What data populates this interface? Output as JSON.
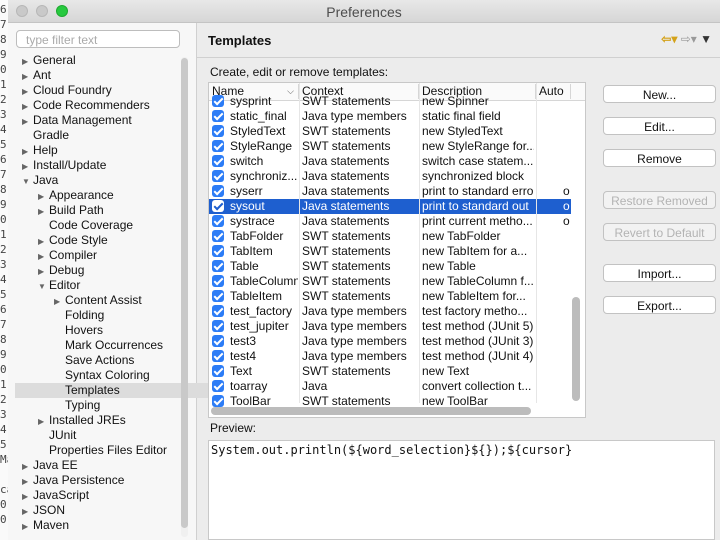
{
  "window": {
    "title": "Preferences"
  },
  "gutter": [
    "6",
    "7",
    "8",
    "9",
    "0",
    "1",
    "2",
    "3",
    "4",
    "5",
    "6",
    "7",
    "8",
    "9",
    "0",
    "1",
    "2",
    "3",
    "4",
    "5",
    "6",
    "7",
    "8",
    "9",
    "0",
    "1",
    "2",
    "3",
    "4",
    "5",
    "Ma",
    "",
    "ca",
    "0",
    "0"
  ],
  "filter": {
    "placeholder": "type filter text"
  },
  "tree": [
    {
      "label": "General",
      "depth": 0,
      "twisty": "right"
    },
    {
      "label": "Ant",
      "depth": 0,
      "twisty": "right"
    },
    {
      "label": "Cloud Foundry",
      "depth": 0,
      "twisty": "right"
    },
    {
      "label": "Code Recommenders",
      "depth": 0,
      "twisty": "right"
    },
    {
      "label": "Data Management",
      "depth": 0,
      "twisty": "right"
    },
    {
      "label": "Gradle",
      "depth": 0,
      "twisty": "none"
    },
    {
      "label": "Help",
      "depth": 0,
      "twisty": "right"
    },
    {
      "label": "Install/Update",
      "depth": 0,
      "twisty": "right"
    },
    {
      "label": "Java",
      "depth": 0,
      "twisty": "down"
    },
    {
      "label": "Appearance",
      "depth": 1,
      "twisty": "right"
    },
    {
      "label": "Build Path",
      "depth": 1,
      "twisty": "right"
    },
    {
      "label": "Code Coverage",
      "depth": 1,
      "twisty": "none"
    },
    {
      "label": "Code Style",
      "depth": 1,
      "twisty": "right"
    },
    {
      "label": "Compiler",
      "depth": 1,
      "twisty": "right"
    },
    {
      "label": "Debug",
      "depth": 1,
      "twisty": "right"
    },
    {
      "label": "Editor",
      "depth": 1,
      "twisty": "down"
    },
    {
      "label": "Content Assist",
      "depth": 2,
      "twisty": "right"
    },
    {
      "label": "Folding",
      "depth": 2,
      "twisty": "none"
    },
    {
      "label": "Hovers",
      "depth": 2,
      "twisty": "none"
    },
    {
      "label": "Mark Occurrences",
      "depth": 2,
      "twisty": "none"
    },
    {
      "label": "Save Actions",
      "depth": 2,
      "twisty": "none"
    },
    {
      "label": "Syntax Coloring",
      "depth": 2,
      "twisty": "none"
    },
    {
      "label": "Templates",
      "depth": 2,
      "twisty": "none",
      "selected": true
    },
    {
      "label": "Typing",
      "depth": 2,
      "twisty": "none"
    },
    {
      "label": "Installed JREs",
      "depth": 1,
      "twisty": "right"
    },
    {
      "label": "JUnit",
      "depth": 1,
      "twisty": "none"
    },
    {
      "label": "Properties Files Editor",
      "depth": 1,
      "twisty": "none"
    },
    {
      "label": "Java EE",
      "depth": 0,
      "twisty": "right"
    },
    {
      "label": "Java Persistence",
      "depth": 0,
      "twisty": "right"
    },
    {
      "label": "JavaScript",
      "depth": 0,
      "twisty": "right"
    },
    {
      "label": "JSON",
      "depth": 0,
      "twisty": "right"
    },
    {
      "label": "Maven",
      "depth": 0,
      "twisty": "right"
    }
  ],
  "page": {
    "title": "Templates",
    "description": "Create, edit or remove templates:",
    "preview_label": "Preview:",
    "preview_text": "System.out.println(${word_selection}${});${cursor}"
  },
  "table": {
    "columns": [
      "Name",
      "Context",
      "Description",
      "Auto"
    ],
    "rows": [
      {
        "name": "sysprint",
        "context": "SWT statements",
        "desc": "new Spinner",
        "auto": ""
      },
      {
        "name": "static_final",
        "context": "Java type members",
        "desc": "static final field",
        "auto": ""
      },
      {
        "name": "StyledText",
        "context": "SWT statements",
        "desc": "new StyledText",
        "auto": ""
      },
      {
        "name": "StyleRange",
        "context": "SWT statements",
        "desc": "new StyleRange for...",
        "auto": ""
      },
      {
        "name": "switch",
        "context": "Java statements",
        "desc": "switch case statem...",
        "auto": ""
      },
      {
        "name": "synchroniz...",
        "context": "Java statements",
        "desc": "synchronized block",
        "auto": ""
      },
      {
        "name": "syserr",
        "context": "Java statements",
        "desc": "print to standard error",
        "auto": "o"
      },
      {
        "name": "sysout",
        "context": "Java statements",
        "desc": "print to standard out",
        "auto": "o",
        "selected": true
      },
      {
        "name": "systrace",
        "context": "Java statements",
        "desc": "print current metho...",
        "auto": "o"
      },
      {
        "name": "TabFolder",
        "context": "SWT statements",
        "desc": "new TabFolder",
        "auto": ""
      },
      {
        "name": "TabItem",
        "context": "SWT statements",
        "desc": "new TabItem for a...",
        "auto": ""
      },
      {
        "name": "Table",
        "context": "SWT statements",
        "desc": "new Table",
        "auto": ""
      },
      {
        "name": "TableColumn",
        "context": "SWT statements",
        "desc": "new TableColumn f...",
        "auto": ""
      },
      {
        "name": "TableItem",
        "context": "SWT statements",
        "desc": "new TableItem for...",
        "auto": ""
      },
      {
        "name": "test_factory",
        "context": "Java type members",
        "desc": "test factory metho...",
        "auto": ""
      },
      {
        "name": "test_jupiter",
        "context": "Java type members",
        "desc": "test method (JUnit 5)",
        "auto": ""
      },
      {
        "name": "test3",
        "context": "Java type members",
        "desc": "test method (JUnit 3)",
        "auto": ""
      },
      {
        "name": "test4",
        "context": "Java type members",
        "desc": "test method (JUnit 4)",
        "auto": ""
      },
      {
        "name": "Text",
        "context": "SWT statements",
        "desc": "new Text",
        "auto": ""
      },
      {
        "name": "toarray",
        "context": "Java",
        "desc": "convert collection t...",
        "auto": ""
      },
      {
        "name": "ToolBar",
        "context": "SWT statements",
        "desc": "new ToolBar",
        "auto": ""
      }
    ]
  },
  "buttons": [
    {
      "label": "New...",
      "enabled": true
    },
    {
      "label": "Edit...",
      "enabled": true
    },
    {
      "label": "Remove",
      "enabled": true
    },
    {
      "label": "Restore Removed",
      "enabled": false
    },
    {
      "label": "Revert to Default",
      "enabled": false
    },
    {
      "label": "Import...",
      "enabled": true
    },
    {
      "label": "Export...",
      "enabled": true
    }
  ],
  "icons": {
    "back": "back-arrow-icon",
    "forward": "forward-arrow-icon",
    "menu": "view-menu-icon"
  },
  "colors": {
    "selection": "#1e5fcf",
    "checkbox": "#2c7cf6",
    "back_arrow": "#d4a21a"
  }
}
